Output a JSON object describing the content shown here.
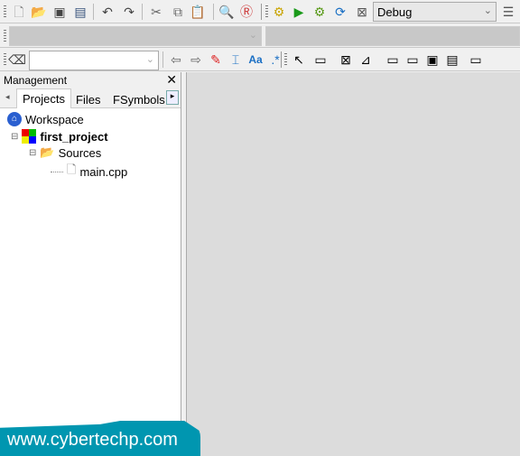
{
  "toolbar": {
    "build_target": "Debug",
    "icons": [
      "new-file",
      "open",
      "save",
      "save-all",
      "undo",
      "redo",
      "cut",
      "copy",
      "paste",
      "find",
      "replace",
      "build-settings",
      "run",
      "build-run",
      "rebuild",
      "abort",
      "target-options"
    ]
  },
  "search_toolbar": {
    "icons": [
      "clear",
      "back",
      "forward",
      "highlight",
      "selection",
      "match-case",
      "regex",
      "pointer",
      "box",
      "nassi-1",
      "nassi-2",
      "nassi-3",
      "nassi-4",
      "nassi-5",
      "nassi-6"
    ]
  },
  "management": {
    "title": "Management",
    "tabs": [
      "Projects",
      "Files",
      "FSymbols"
    ],
    "active_tab": "Projects",
    "tree": {
      "workspace": "Workspace",
      "project": "first_project",
      "folder": "Sources",
      "file": "main.cpp"
    }
  },
  "watermark": "www.cybertechp.com",
  "colors": {
    "watermark": "#0096b0",
    "editor_bg": "#dcdcdc"
  }
}
